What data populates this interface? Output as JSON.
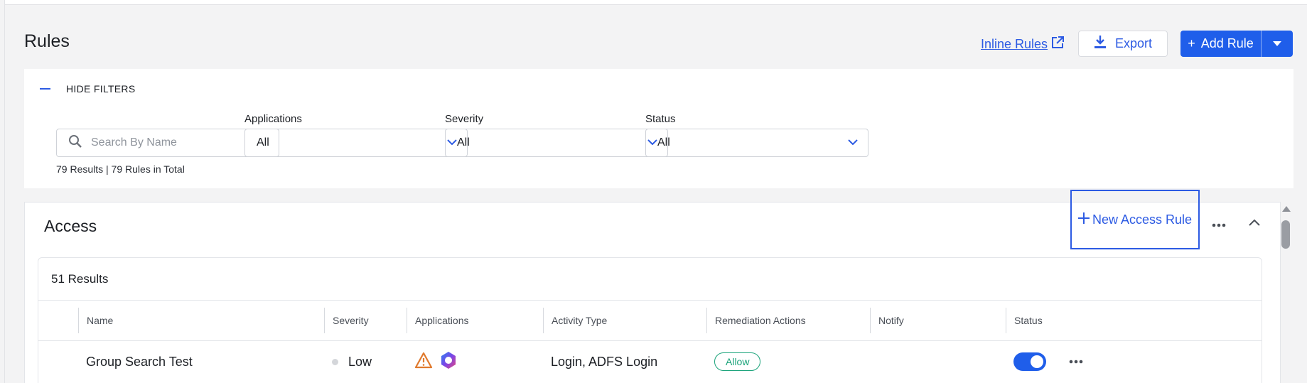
{
  "page": {
    "title": "Rules"
  },
  "header": {
    "inline_rules_label": "Inline Rules",
    "export_label": "Export",
    "add_rule_label": "Add Rule"
  },
  "filters": {
    "toggle_label": "HIDE FILTERS",
    "search_placeholder": "Search By Name",
    "results_summary": "79 Results | 79 Rules in Total",
    "applications": {
      "label": "Applications",
      "value": "All"
    },
    "severity": {
      "label": "Severity",
      "value": "All"
    },
    "status": {
      "label": "Status",
      "value": "All"
    }
  },
  "access": {
    "title": "Access",
    "new_rule_label": "New Access Rule",
    "results_count": "51 Results",
    "columns": [
      "Name",
      "Severity",
      "Applications",
      "Activity Type",
      "Remediation Actions",
      "Notify",
      "Status"
    ],
    "rows": [
      {
        "name": "Group Search Test",
        "severity": "Low",
        "applications": [
          "warning-icon",
          "copilot-icon"
        ],
        "activity_type": "Login, ADFS Login",
        "remediation": "Allow",
        "notify": "",
        "status_on": true
      }
    ]
  },
  "colors": {
    "accent": "#1f5eea",
    "link": "#2d5be3",
    "allow": "#1aa37a",
    "warning": "#e07a2e"
  }
}
